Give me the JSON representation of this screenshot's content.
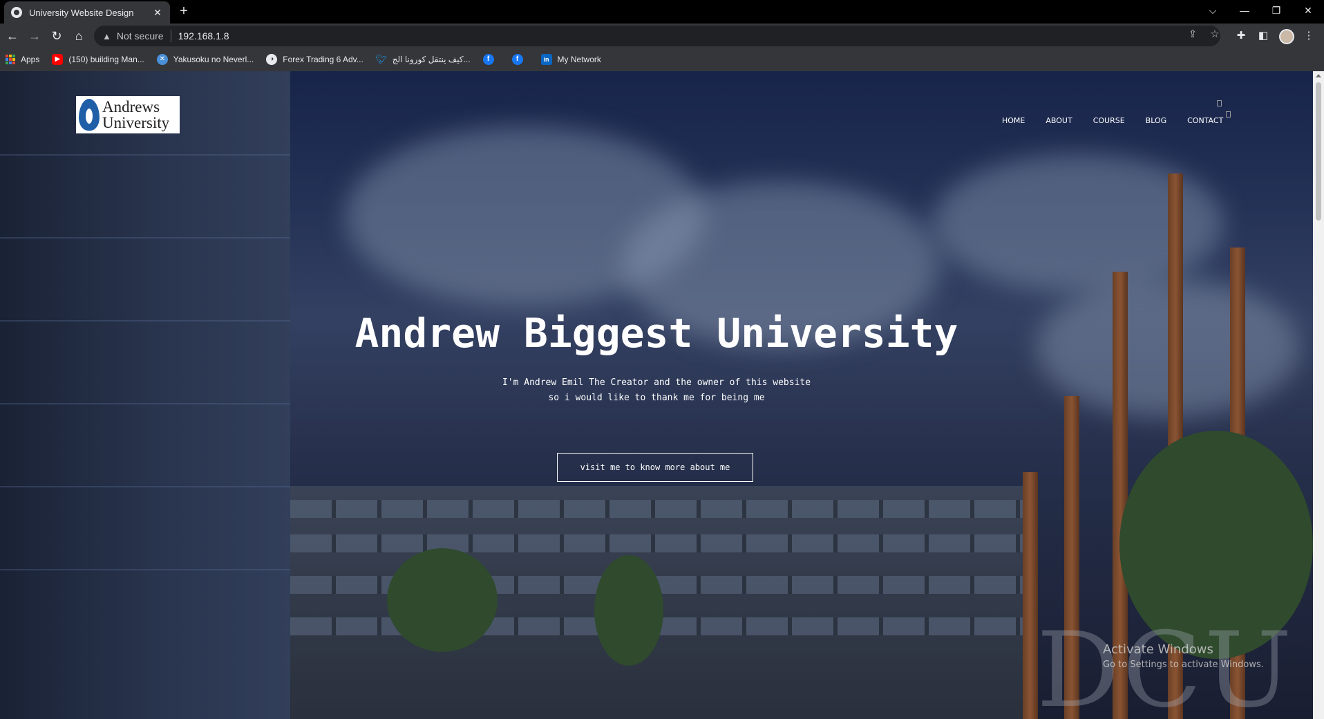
{
  "browser": {
    "tab_title": "University Website Design",
    "tab_close": "✕",
    "new_tab": "+",
    "security_label": "Not secure",
    "url": "192.168.1.8",
    "bookmarks": [
      {
        "label": "Apps",
        "icon": "apps-grid-icon"
      },
      {
        "label": "(150) building Man...",
        "icon": "youtube-icon"
      },
      {
        "label": "Yakusoku no Neverl...",
        "icon": "yakusoku-icon"
      },
      {
        "label": "Forex Trading 6 Adv...",
        "icon": "globe-icon"
      },
      {
        "label": "كيف ينتقل كورونا الج...",
        "icon": "twitter-icon"
      },
      {
        "label": "",
        "icon": "facebook-icon"
      },
      {
        "label": "",
        "icon": "facebook-icon"
      },
      {
        "label": "My Network",
        "icon": "linkedin-icon"
      }
    ]
  },
  "site": {
    "logo_line1": "Andrews",
    "logo_line2": "University",
    "nav": [
      "HOME",
      "ABOUT",
      "COURSE",
      "BLOG",
      "CONTACT"
    ],
    "hero_title": "Andrew Biggest University",
    "hero_sub_line1": "I'm Andrew Emil The Creator and the owner of this website",
    "hero_sub_line2": "so i would like to thank me for being me",
    "hero_button": "visit me to know more about me",
    "watermark": "DCU"
  },
  "os": {
    "activate_title": "Activate Windows",
    "activate_sub": "Go to Settings to activate Windows."
  },
  "colors": {
    "overlay": "#1c2b4f",
    "chrome_dark": "#35363a",
    "text_light": "#e8eaed"
  }
}
